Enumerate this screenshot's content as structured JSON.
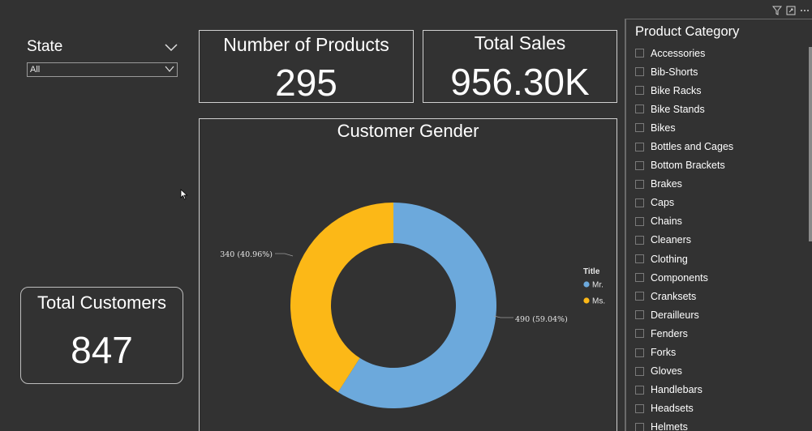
{
  "state_slicer": {
    "title": "State",
    "selected": "All"
  },
  "cards": {
    "products": {
      "title": "Number of Products",
      "value": "295"
    },
    "sales": {
      "title": "Total Sales",
      "value": "956.30K"
    },
    "customers": {
      "title": "Total Customers",
      "value": "847"
    }
  },
  "chart_data": {
    "type": "pie",
    "title": "Customer Gender",
    "legend_title": "Title",
    "legend_position": "right",
    "donut": true,
    "slices": [
      {
        "name": "Mr.",
        "value": 490,
        "percent": 59.04,
        "label": "490 (59.04%)",
        "color": "#6CA9DC"
      },
      {
        "name": "Ms.",
        "value": 340,
        "percent": 40.96,
        "label": "340 (40.96%)",
        "color": "#FCB817"
      }
    ]
  },
  "category_slicer": {
    "title": "Product Category",
    "items": [
      "Accessories",
      "Bib-Shorts",
      "Bike Racks",
      "Bike Stands",
      "Bikes",
      "Bottles and Cages",
      "Bottom Brackets",
      "Brakes",
      "Caps",
      "Chains",
      "Cleaners",
      "Clothing",
      "Components",
      "Cranksets",
      "Derailleurs",
      "Fenders",
      "Forks",
      "Gloves",
      "Handlebars",
      "Headsets",
      "Helmets"
    ]
  },
  "icons": [
    "filter-icon",
    "focus-mode-icon",
    "more-options-icon",
    "chevron-down-icon"
  ]
}
